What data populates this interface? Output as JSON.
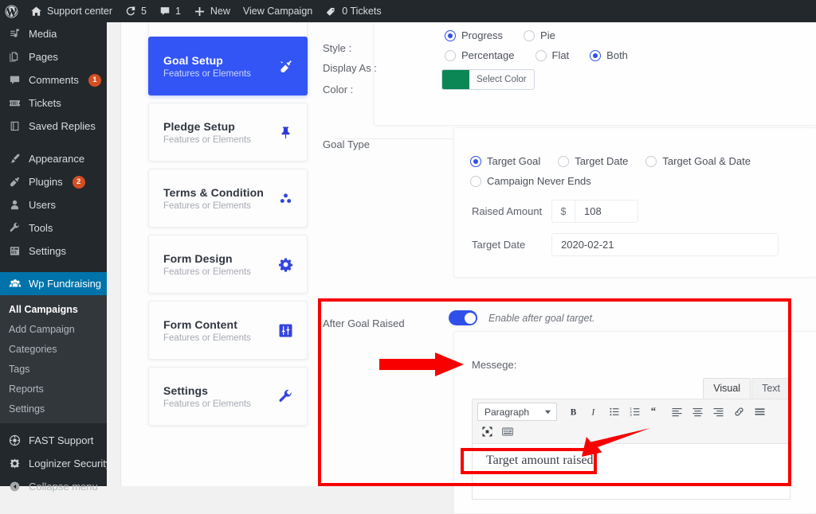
{
  "adminbar": {
    "items": [
      {
        "name": "wordpress-logo",
        "icon": "wordpress-icon",
        "label": ""
      },
      {
        "name": "site-name",
        "icon": "home-icon",
        "label": "Support center"
      },
      {
        "name": "updates",
        "icon": "updates-icon",
        "label": "5"
      },
      {
        "name": "comments",
        "icon": "comment-icon",
        "label": "1"
      },
      {
        "name": "new-content",
        "icon": "plus-icon",
        "label": "New"
      },
      {
        "name": "view-campaign",
        "icon": "",
        "label": "View Campaign"
      },
      {
        "name": "tickets",
        "icon": "tag-icon",
        "label": "0 Tickets"
      }
    ]
  },
  "sidebar": {
    "items": [
      {
        "label": "Media",
        "icon": "media-icon",
        "badge": null,
        "active": false
      },
      {
        "label": "Pages",
        "icon": "pages-icon",
        "badge": null,
        "active": false
      },
      {
        "label": "Comments",
        "icon": "comments-icon",
        "badge": "1",
        "active": false
      },
      {
        "label": "Tickets",
        "icon": "tickets-icon",
        "badge": null,
        "active": false
      },
      {
        "label": "Saved Replies",
        "icon": "book-icon",
        "badge": null,
        "active": false
      },
      {
        "label": "Appearance",
        "icon": "brush-icon",
        "badge": null,
        "active": false
      },
      {
        "label": "Plugins",
        "icon": "plugin-icon",
        "badge": "2",
        "active": false
      },
      {
        "label": "Users",
        "icon": "user-icon",
        "badge": null,
        "active": false
      },
      {
        "label": "Tools",
        "icon": "wrench-icon",
        "badge": null,
        "active": false
      },
      {
        "label": "Settings",
        "icon": "settings-icon",
        "badge": null,
        "active": false
      }
    ],
    "active_item": {
      "label": "Wp Fundraising",
      "icon": "fundraising-icon"
    },
    "submenu": [
      {
        "label": "All Campaigns",
        "current": true
      },
      {
        "label": "Add Campaign",
        "current": false
      },
      {
        "label": "Categories",
        "current": false
      },
      {
        "label": "Tags",
        "current": false
      },
      {
        "label": "Reports",
        "current": false
      },
      {
        "label": "Settings",
        "current": false
      }
    ],
    "bottom_items": [
      {
        "label": "FAST Support",
        "icon": "fast-support-icon"
      },
      {
        "label": "Loginizer Security",
        "icon": "shield-gear-icon"
      }
    ],
    "collapse": {
      "label": "Collapse menu",
      "icon": "collapse-icon"
    }
  },
  "tabs": [
    {
      "label": "Goal Setup",
      "sub": "Features or Elements",
      "icon": "plug-icon",
      "active": true
    },
    {
      "label": "Pledge Setup",
      "sub": "Features or Elements",
      "icon": "pin-icon",
      "active": false
    },
    {
      "label": "Terms & Condition",
      "sub": "Features or Elements",
      "icon": "group-dots-icon",
      "active": false
    },
    {
      "label": "Form Design",
      "sub": "Features or Elements",
      "icon": "gear-icon",
      "active": false
    },
    {
      "label": "Form Content",
      "sub": "Features or Elements",
      "icon": "sliders-icon",
      "active": false
    },
    {
      "label": "Settings",
      "sub": "Features or Elements",
      "icon": "wrench-icon",
      "active": false
    }
  ],
  "style_section": {
    "style_label": "Style :",
    "style_options": [
      {
        "label": "Progress",
        "selected": true
      },
      {
        "label": "Pie",
        "selected": false
      }
    ],
    "display_label": "Display As :",
    "display_options": [
      {
        "label": "Percentage",
        "selected": false
      },
      {
        "label": "Flat",
        "selected": false
      },
      {
        "label": "Both",
        "selected": true
      }
    ],
    "color_label": "Color :",
    "color_button_label": "Select Color",
    "color_value": "#0a8754"
  },
  "goal_type": {
    "label": "Goal Type",
    "options": [
      {
        "label": "Target Goal",
        "selected": true
      },
      {
        "label": "Target Date",
        "selected": false
      },
      {
        "label": "Target Goal & Date",
        "selected": false
      },
      {
        "label": "Campaign Never Ends",
        "selected": false
      }
    ],
    "raised_amount": {
      "label": "Raised Amount",
      "prefix": "$",
      "value": "108"
    },
    "target_date": {
      "label": "Target Date",
      "value": "2020-02-21"
    }
  },
  "after_goal": {
    "label": "After Goal Raised",
    "toggle_on": true,
    "toggle_hint": "Enable after goal target.",
    "message_label": "Messege:",
    "editor": {
      "tabs": [
        {
          "label": "Visual",
          "selected": true
        },
        {
          "label": "Text",
          "selected": false
        }
      ],
      "format_select": "Paragraph",
      "toolbar_row1": [
        "bold-icon",
        "italic-icon",
        "bulleted-list-icon",
        "numbered-list-icon",
        "blockquote-icon",
        "align-left-icon",
        "align-center-icon",
        "align-right-icon",
        "link-icon",
        "read-more-icon"
      ],
      "toolbar_row2": [
        "fullscreen-icon",
        "keyboard-shortcuts-icon"
      ],
      "body_text": "Target amount raised"
    }
  },
  "annotations": {
    "accent_red": "#f90000",
    "accent_blue": "#3355f5",
    "wp_blue": "#0073aa"
  }
}
